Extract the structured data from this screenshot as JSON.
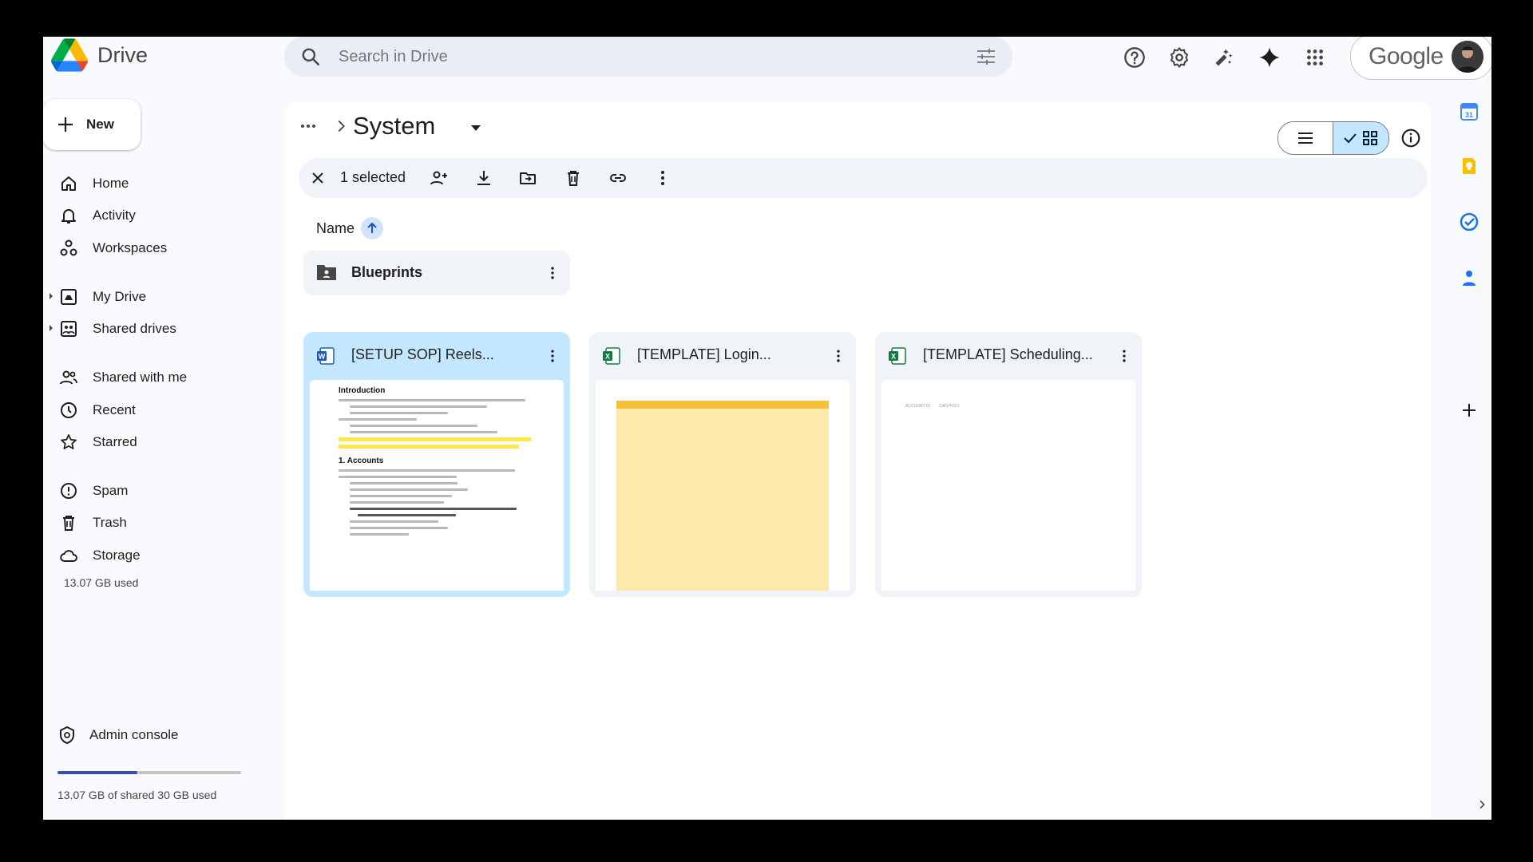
{
  "app": {
    "name": "Drive",
    "brand": "Google"
  },
  "search": {
    "placeholder": "Search in Drive"
  },
  "sidebar": {
    "new_label": "New",
    "groups": [
      {
        "items": [
          {
            "label": "Home",
            "icon": "home-icon"
          },
          {
            "label": "Activity",
            "icon": "bell-icon"
          },
          {
            "label": "Workspaces",
            "icon": "workspaces-icon"
          }
        ]
      },
      {
        "items": [
          {
            "label": "My Drive",
            "icon": "my-drive-icon"
          },
          {
            "label": "Shared drives",
            "icon": "shared-drives-icon"
          }
        ]
      },
      {
        "items": [
          {
            "label": "Shared with me",
            "icon": "people-icon"
          },
          {
            "label": "Recent",
            "icon": "clock-icon"
          },
          {
            "label": "Starred",
            "icon": "star-icon"
          }
        ]
      },
      {
        "items": [
          {
            "label": "Spam",
            "icon": "spam-icon"
          },
          {
            "label": "Trash",
            "icon": "trash-icon"
          },
          {
            "label": "Storage",
            "icon": "cloud-icon"
          }
        ]
      }
    ],
    "storage_used": "13.07 GB used",
    "admin_label": "Admin console",
    "quota_text": "13.07 GB of shared 30 GB used",
    "quota_fraction": 0.4357
  },
  "breadcrumb": {
    "title": "System"
  },
  "selection": {
    "count_text": "1 selected"
  },
  "sort": {
    "label": "Name"
  },
  "folders": [
    {
      "name": "Blueprints"
    }
  ],
  "files": [
    {
      "name": "[SETUP SOP] Reels...",
      "type": "word",
      "selected": true
    },
    {
      "name": "[TEMPLATE] Login...",
      "type": "excel",
      "selected": false
    },
    {
      "name": "[TEMPLATE] Scheduling...",
      "type": "excel",
      "selected": false
    }
  ],
  "doc_preview": {
    "heading1": "Introduction",
    "heading2": "1. Accounts"
  },
  "sheet_preview": {
    "col1": "ACCOUNT ID",
    "col2": "CAN POST"
  },
  "colors": {
    "accent": "#0b57d0",
    "selected_bg": "#c2e7ff",
    "quota_fill": "#3c4da8"
  }
}
